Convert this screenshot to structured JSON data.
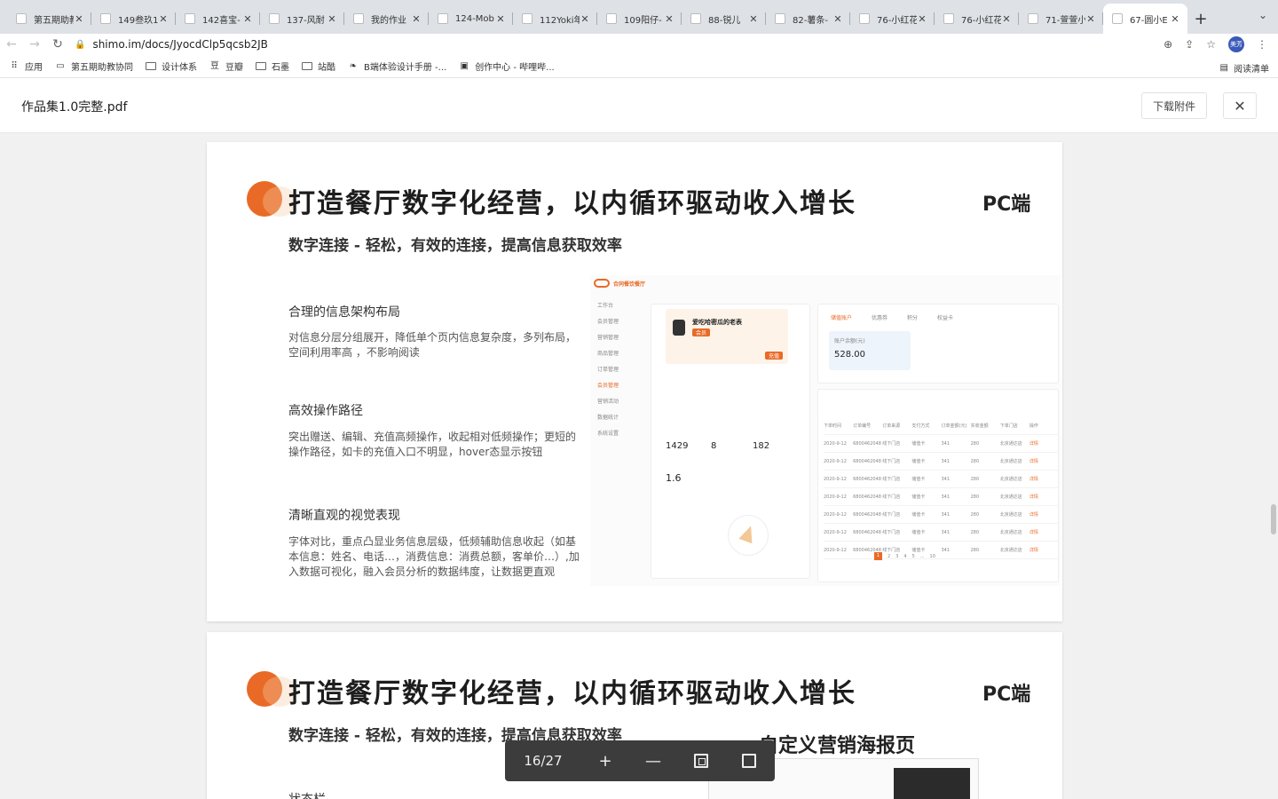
{
  "browser": {
    "tabs": [
      {
        "title": "第五期助教",
        "active": false
      },
      {
        "title": "149叁玖1",
        "active": false
      },
      {
        "title": "142喜宝-",
        "active": false
      },
      {
        "title": "137-风耐",
        "active": false
      },
      {
        "title": "我的作业",
        "active": false
      },
      {
        "title": "124-Mob",
        "active": false
      },
      {
        "title": "112Yoki年",
        "active": false
      },
      {
        "title": "109阳仔-",
        "active": false
      },
      {
        "title": "88-锐儿",
        "active": false
      },
      {
        "title": "82-薯条-",
        "active": false
      },
      {
        "title": "76-小红花",
        "active": false
      },
      {
        "title": "76-小红花",
        "active": false
      },
      {
        "title": "71-萱萱小",
        "active": false
      },
      {
        "title": "67-圆小E",
        "active": true
      }
    ],
    "url": "shimo.im/docs/JyocdClp5qcsb2JB",
    "avatar_text": "美芳",
    "bookmarks": [
      {
        "label": "应用",
        "icon": "apps-grid-icon"
      },
      {
        "label": "第五期助教协同",
        "icon": "page-icon"
      },
      {
        "label": "设计体系",
        "icon": "folder-icon"
      },
      {
        "label": "豆瓣",
        "icon": "douban-icon"
      },
      {
        "label": "石墨",
        "icon": "folder-icon"
      },
      {
        "label": "站酷",
        "icon": "folder-icon"
      },
      {
        "label": "B端体验设计手册 -...",
        "icon": "leaf-icon"
      },
      {
        "label": "创作中心 - 哔哩哔...",
        "icon": "bilibili-icon"
      }
    ],
    "reading_list": "阅读清单"
  },
  "doc": {
    "file_name": "作品集1.0完整.pdf",
    "download_label": "下载附件",
    "close_label": "✕"
  },
  "page1": {
    "title": "打造餐厅数字化经营，以内循环驱动收入增长",
    "platform": "PC端",
    "subtitle": "数字连接 - 轻松，有效的连接，提高信息获取效率",
    "features": [
      {
        "title": "合理的信息架构布局",
        "desc": "对信息分层分组展开，降低单个页内信息复杂度，多列布局，空间利用率高 ，不影响阅读"
      },
      {
        "title": "高效操作路径",
        "desc": "突出赠送、编辑、充值高频操作，收起相对低频操作；更短的操作路径，如卡的充值入口不明显，hover态显示按钮"
      },
      {
        "title": "清晰直观的视觉表现",
        "desc": "字体对比，重点凸显业务信息层级，低频辅助信息收起（如基本信息：姓名、电话…，消费信息：消费总额，客单价…）,加入数据可视化，融入会员分析的数据纬度，让数据更直观"
      }
    ],
    "mockup": {
      "brand": "合同餐饮餐厅",
      "nav": [
        "工作台",
        "会员管理",
        "营销管理",
        "商品管理",
        "订单管理",
        "会员管理",
        "营销活动",
        "数据统计",
        "系统设置"
      ],
      "customer_name": "爱吃哈密瓜的老表",
      "amount_label": "账户余额(元)",
      "amount": "528.00",
      "stats": [
        "1429",
        "8",
        "182"
      ],
      "score": "1.6",
      "tabs": [
        "储值账户",
        "优惠券",
        "积分",
        "权益卡"
      ],
      "table_head": [
        "下单时间",
        "订单编号",
        "订单来源",
        "支付方式",
        "订单金额(元)",
        "实收金额",
        "下单门店",
        "操作"
      ],
      "table_row": [
        "2020-9-12",
        "6800462048",
        "线下门店",
        "储值卡",
        "341",
        "280",
        "北京通达店",
        "详情"
      ],
      "pagination": [
        "1",
        "2",
        "3",
        "4",
        "5",
        "...",
        "10"
      ]
    }
  },
  "page2": {
    "title": "打造餐厅数字化经营，以内循环驱动收入增长",
    "platform": "PC端",
    "subtitle": "数字连接 - 轻松，有效的连接，提高信息获取效率",
    "poster_title": "自定义营销海报页",
    "feature_cut": "状态栏"
  },
  "pdf_toolbar": {
    "page_indicator": "16/27",
    "zoom_in": "+",
    "zoom_out": "—"
  },
  "colors": {
    "accent": "#e96a26",
    "toolbar_bg": "#3c3c3c"
  }
}
